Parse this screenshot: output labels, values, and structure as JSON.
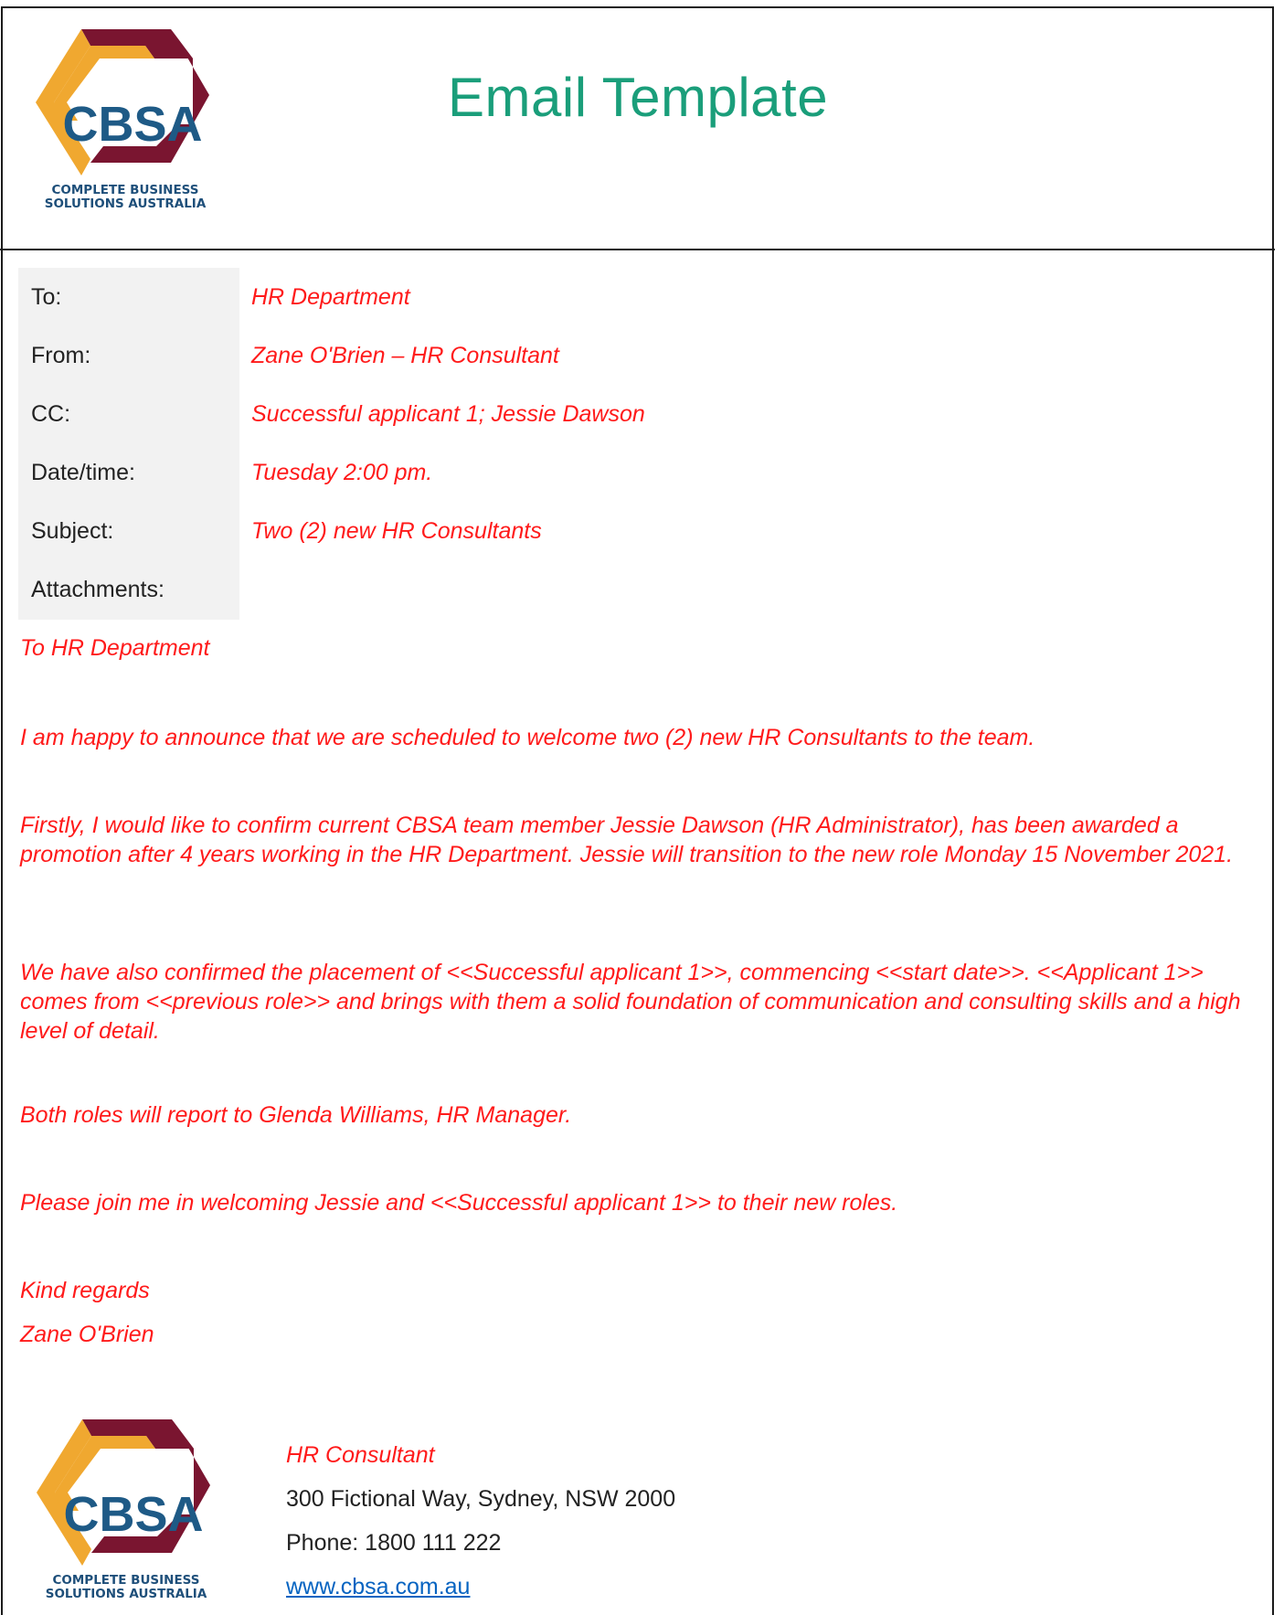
{
  "header": {
    "title": "Email Template",
    "logo": {
      "wordmark": "CBSA",
      "tagline_line1": "COMPLETE BUSINESS",
      "tagline_line2": "SOLUTIONS AUSTRALIA"
    }
  },
  "fields": [
    {
      "label": "To:",
      "value": "HR Department"
    },
    {
      "label": "From:",
      "value": "Zane O'Brien – HR Consultant"
    },
    {
      "label": "CC:",
      "value": "Successful applicant 1; Jessie Dawson"
    },
    {
      "label": "Date/time:",
      "value": "Tuesday 2:00 pm."
    },
    {
      "label": "Subject:",
      "value": "Two (2) new HR Consultants"
    },
    {
      "label": "Attachments:",
      "value": ""
    }
  ],
  "body": {
    "greeting": "To HR Department",
    "p1": "I am happy to announce that we are scheduled to welcome two (2) new HR Consultants to the team.",
    "p2": "Firstly, I would like to confirm current CBSA team member Jessie Dawson (HR Administrator), has been awarded a promotion after 4 years working in the HR Department. Jessie will transition to the new role Monday 15 November 2021.",
    "p3": "We have also confirmed the placement of <<Successful applicant 1>>, commencing <<start date>>. <<Applicant 1>> comes from <<previous role>> and brings with them a solid foundation of communication and consulting skills and a high level of detail.",
    "p4": "Both roles will report to Glenda Williams, HR Manager.",
    "p5": "Please join me in welcoming Jessie and <<Successful applicant 1>> to their new roles.",
    "closing": "Kind regards",
    "signer": "Zane O'Brien"
  },
  "signature": {
    "title": "HR Consultant",
    "address": "300 Fictional Way, Sydney, NSW 2000",
    "phone": "Phone: 1800 111 222",
    "website": "www.cbsa.com.au"
  },
  "colors": {
    "title_green": "#1a9e7a",
    "body_red": "#ff1a1a",
    "logo_maroon": "#7a1530",
    "logo_gold": "#f0a830",
    "logo_blue": "#1e5a86",
    "link_blue": "#0563c1"
  }
}
